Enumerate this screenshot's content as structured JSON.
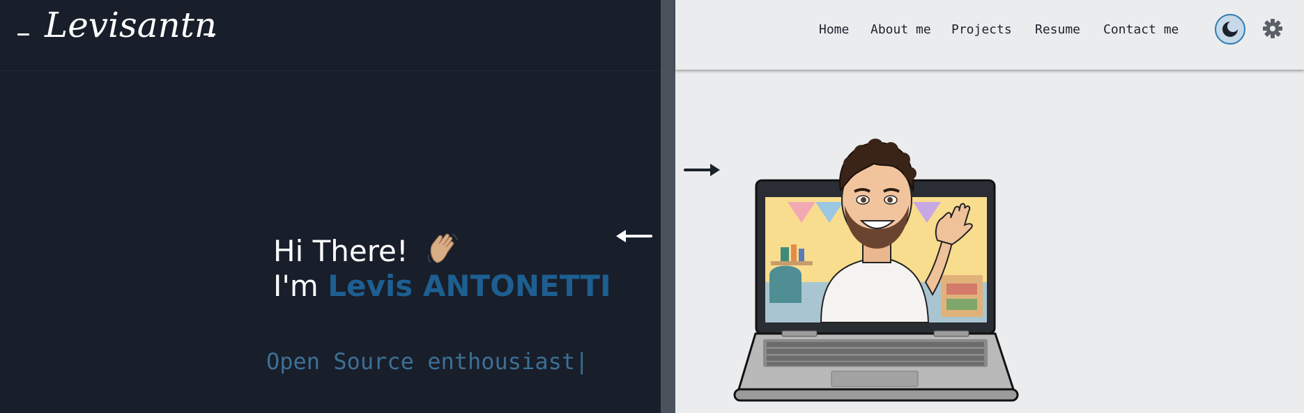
{
  "logo": {
    "text": "Levisantn",
    "prefix": "_",
    "suffix": "_"
  },
  "nav": {
    "items": [
      {
        "label": "Home"
      },
      {
        "label": "About me"
      },
      {
        "label": "Projects"
      },
      {
        "label": "Resume"
      },
      {
        "label": "Contact me"
      }
    ]
  },
  "controls": {
    "theme_icon": "moon-icon",
    "settings_icon": "gear-icon"
  },
  "hero": {
    "greeting": "Hi There!",
    "greeting_emoji": "waving-hand",
    "im_prefix": "I'm",
    "name": "Levis ANTONETTI",
    "typed_text": "Open Source enthousiast",
    "cursor": "|"
  },
  "colors": {
    "dark_bg": "#181e2a",
    "light_bg": "#ebecee",
    "accent": "#1d5f91",
    "typed": "#3d6f94"
  }
}
